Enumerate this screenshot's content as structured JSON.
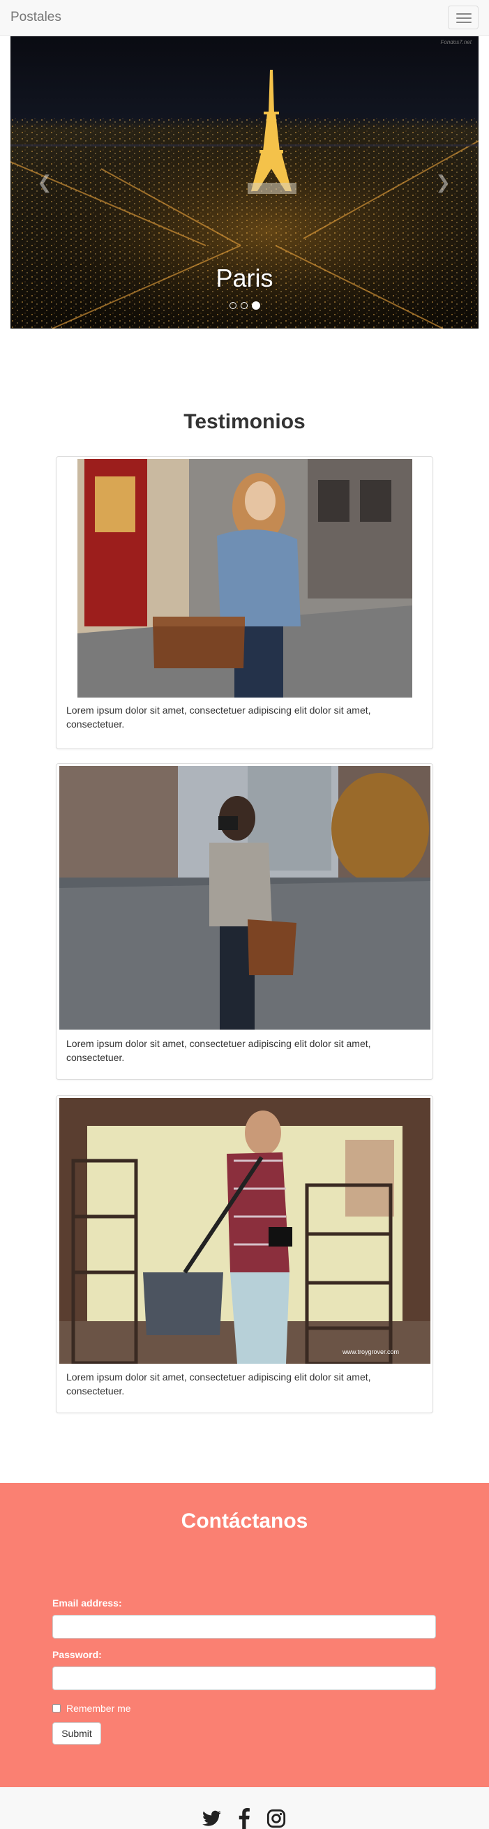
{
  "navbar": {
    "brand": "Postales",
    "toggle_icon": "hamburger-menu-icon"
  },
  "carousel": {
    "watermark": "Fondos7.net",
    "caption": "Paris",
    "slide_count": 3,
    "active_slide": 3,
    "prev_icon": "chevron-left-icon",
    "next_icon": "chevron-right-icon"
  },
  "testimonials": {
    "title": "Testimonios",
    "items": [
      {
        "text": "Lorem ipsum dolor sit amet, consectetuer adipiscing elit dolor sit amet, consectetuer."
      },
      {
        "text": "Lorem ipsum dolor sit amet, consectetuer adipiscing elit dolor sit amet, consectetuer."
      },
      {
        "text": "Lorem ipsum dolor sit amet, consectetuer adipiscing elit dolor sit amet, consectetuer.",
        "photo_watermark": "www.troygrover.com"
      }
    ]
  },
  "contact": {
    "title": "Contáctanos",
    "email_label": "Email address:",
    "email_value": "",
    "password_label": "Password:",
    "password_value": "",
    "remember_label": "Remember me",
    "submit_label": "Submit",
    "background_color": "#fa8072"
  },
  "footer": {
    "icons": [
      "twitter-icon",
      "facebook-icon",
      "instagram-icon"
    ]
  }
}
